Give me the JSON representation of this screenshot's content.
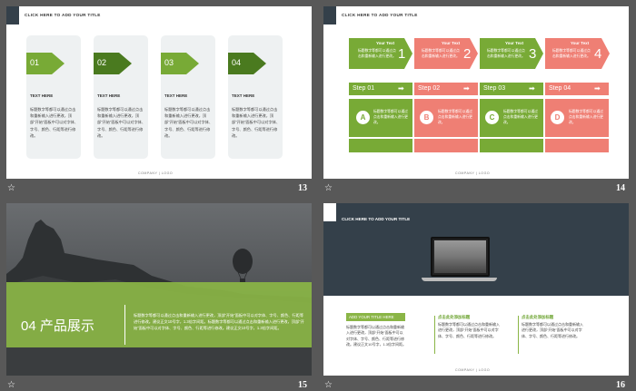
{
  "colors": {
    "background": "#585858",
    "green": "#78aa36",
    "dark_green": "#4a7a1f",
    "salmon": "#ef7f74",
    "dark": "#34404a"
  },
  "slides": [
    {
      "number": "13",
      "title": "CLICK HERE TO ADD YOUR TITLE",
      "cards": [
        {
          "num": "01",
          "heading": "TEXT HERE",
          "body": "标题数字等都可以通过点击和重新输入进行更改，顶部“开始”面板中可以对字体、字号、颜色、行距等进行修改。"
        },
        {
          "num": "02",
          "heading": "TEXT HERE",
          "body": "标题数字等都可以通过点击和重新输入进行更改，顶部“开始”面板中可以对字体、字号、颜色、行距等进行修改。"
        },
        {
          "num": "03",
          "heading": "TEXT HERE",
          "body": "标题数字等都可以通过点击和重新输入进行更改，顶部“开始”面板中可以对字体、字号、颜色、行距等进行修改。"
        },
        {
          "num": "04",
          "heading": "TEXT HERE",
          "body": "标题数字等都可以通过点击和重新输入进行更改，顶部“开始”面板中可以对字体、字号、颜色、行距等进行修改。"
        }
      ],
      "footer": "COMPANY  |  LOGO"
    },
    {
      "number": "14",
      "title": "CLICK HERE TO ADD YOUR TITLE",
      "ribbons": [
        {
          "title": "Your Text",
          "sub": "标题数字等都可以通过点击和重新输入进行更改。",
          "num": "1"
        },
        {
          "title": "Your Text",
          "sub": "标题数字等都可以通过点击和重新输入进行更改。",
          "num": "2"
        },
        {
          "title": "Your Text",
          "sub": "标题数字等都可以通过点击和重新输入进行更改。",
          "num": "3"
        },
        {
          "title": "Your Text",
          "sub": "标题数字等都可以通过点击和重新输入进行更改。",
          "num": "4"
        }
      ],
      "steps": [
        {
          "label": "Step 01",
          "letter": "A",
          "text": "标题数字等都可以通过点击和重新输入进行更改。"
        },
        {
          "label": "Step 02",
          "letter": "B",
          "text": "标题数字等都可以通过点击和重新输入进行更改。"
        },
        {
          "label": "Step 03",
          "letter": "C",
          "text": "标题数字等都可以通过点击和重新输入进行更改。"
        },
        {
          "label": "Step 04",
          "letter": "D",
          "text": "标题数字等都可以通过点击和重新输入进行更改。"
        }
      ],
      "footer": "COMPANY  |  LOGO"
    },
    {
      "number": "15",
      "band_title": "04 产品展示",
      "band_body": "标题数字等都可以通过点击和重新输入进行更改，顶部“开始”面板中可以对字体、字号、颜色、行距等进行修改。建议正文10号字，1.3倍字间距。标题数字等都可以通过点击和重新输入进行更改，顶部“开始”面板中可以对字体、字号、颜色、行距等进行修改。建议正文10号字，1.3倍字间距。"
    },
    {
      "number": "16",
      "title": "CLICK HERE TO ADD YOUR TITLE",
      "add_title": "ADD YOUR TITLE HERE",
      "left_body": "标题数字等都可以通过点击和重新输入进行更改，顶部“开始”面板中可以对字体、字号、颜色、行距等进行修改。建议正文10号字，1.3倍字间距。",
      "columns": [
        {
          "head": "点击此处添加标题",
          "body": "标题数字等都可以通过点击和重新输入进行更改，顶部“开始”面板中可以对字体、字号、颜色、行距等进行修改。"
        },
        {
          "head": "点击此处添加标题",
          "body": "标题数字等都可以通过点击和重新输入进行更改，顶部“开始”面板中可以对字体、字号、颜色、行距等进行修改。"
        }
      ],
      "footer": "COMPANY  |  LOGO"
    }
  ]
}
